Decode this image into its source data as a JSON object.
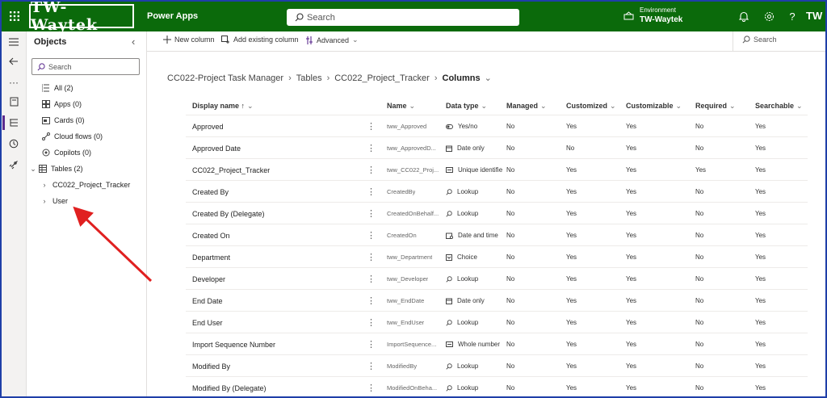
{
  "topbar": {
    "logo": "TW-Waytek",
    "app_name": "Power Apps",
    "search_placeholder": "Search",
    "environment_label": "Environment",
    "environment_name": "TW-Waytek",
    "avatar": "TW",
    "icons": [
      "waffle-icon",
      "notifications-icon",
      "settings-icon",
      "help-icon"
    ]
  },
  "objects": {
    "title": "Objects",
    "search_placeholder": "Search",
    "items": [
      {
        "label": "All",
        "count": "(2)",
        "icon": "list-icon"
      },
      {
        "label": "Apps",
        "count": "(0)",
        "icon": "apps-icon"
      },
      {
        "label": "Cards",
        "count": "(0)",
        "icon": "cards-icon"
      },
      {
        "label": "Cloud flows",
        "count": "(0)",
        "icon": "flow-icon"
      },
      {
        "label": "Copilots",
        "count": "(0)",
        "icon": "copilot-icon"
      },
      {
        "label": "Tables",
        "count": "(2)",
        "icon": "table-icon"
      }
    ],
    "tables": [
      "CC022_Project_Tracker",
      "User"
    ]
  },
  "commands": {
    "new_column": "New column",
    "add_existing": "Add existing column",
    "advanced": "Advanced",
    "search": "Search"
  },
  "breadcrumb": {
    "solution": "CC022-Project Task Manager",
    "tables": "Tables",
    "table": "CC022_Project_Tracker",
    "current": "Columns"
  },
  "grid": {
    "headers": [
      "Display name ↑",
      "Name",
      "Data type",
      "Managed",
      "Customized",
      "Customizable",
      "Required",
      "Searchable"
    ],
    "rows": [
      {
        "display": "Approved",
        "name": "tww_Approved",
        "type": "Yes/no",
        "type_icon": "toggle-icon",
        "managed": "No",
        "customized": "Yes",
        "customizable": "Yes",
        "required": "No",
        "searchable": "Yes"
      },
      {
        "display": "Approved Date",
        "name": "tww_ApprovedD...",
        "type": "Date only",
        "type_icon": "calendar-icon",
        "managed": "No",
        "customized": "No",
        "customizable": "Yes",
        "required": "No",
        "searchable": "Yes"
      },
      {
        "display": "CC022_Project_Tracker",
        "name": "tww_CC022_Proj...",
        "type": "Unique identifie",
        "type_icon": "id-icon",
        "managed": "No",
        "customized": "Yes",
        "customizable": "Yes",
        "required": "Yes",
        "searchable": "Yes"
      },
      {
        "display": "Created By",
        "name": "CreatedBy",
        "type": "Lookup",
        "type_icon": "lookup-icon",
        "managed": "No",
        "customized": "Yes",
        "customizable": "Yes",
        "required": "No",
        "searchable": "Yes"
      },
      {
        "display": "Created By (Delegate)",
        "name": "CreatedOnBehalf...",
        "type": "Lookup",
        "type_icon": "lookup-icon",
        "managed": "No",
        "customized": "Yes",
        "customizable": "Yes",
        "required": "No",
        "searchable": "Yes"
      },
      {
        "display": "Created On",
        "name": "CreatedOn",
        "type": "Date and time",
        "type_icon": "datetime-icon",
        "managed": "No",
        "customized": "Yes",
        "customizable": "Yes",
        "required": "No",
        "searchable": "Yes"
      },
      {
        "display": "Department",
        "name": "tww_Department",
        "type": "Choice",
        "type_icon": "choice-icon",
        "managed": "No",
        "customized": "Yes",
        "customizable": "Yes",
        "required": "No",
        "searchable": "Yes"
      },
      {
        "display": "Developer",
        "name": "tww_Developer",
        "type": "Lookup",
        "type_icon": "lookup-icon",
        "managed": "No",
        "customized": "Yes",
        "customizable": "Yes",
        "required": "No",
        "searchable": "Yes"
      },
      {
        "display": "End Date",
        "name": "tww_EndDate",
        "type": "Date only",
        "type_icon": "calendar-icon",
        "managed": "No",
        "customized": "Yes",
        "customizable": "Yes",
        "required": "No",
        "searchable": "Yes"
      },
      {
        "display": "End User",
        "name": "tww_EndUser",
        "type": "Lookup",
        "type_icon": "lookup-icon",
        "managed": "No",
        "customized": "Yes",
        "customizable": "Yes",
        "required": "No",
        "searchable": "Yes"
      },
      {
        "display": "Import Sequence Number",
        "name": "ImportSequence...",
        "type": "Whole number",
        "type_icon": "number-icon",
        "managed": "No",
        "customized": "Yes",
        "customizable": "Yes",
        "required": "No",
        "searchable": "Yes"
      },
      {
        "display": "Modified By",
        "name": "ModifiedBy",
        "type": "Lookup",
        "type_icon": "lookup-icon",
        "managed": "No",
        "customized": "Yes",
        "customizable": "Yes",
        "required": "No",
        "searchable": "Yes"
      },
      {
        "display": "Modified By (Delegate)",
        "name": "ModifiedOnBeha...",
        "type": "Lookup",
        "type_icon": "lookup-icon",
        "managed": "No",
        "customized": "Yes",
        "customizable": "Yes",
        "required": "No",
        "searchable": "Yes"
      }
    ]
  },
  "colors": {
    "topbar": "#0b6a0b",
    "outer_border": "#1f3fa8",
    "active_rail": "#5b2b8e",
    "annotation_arrow": "#e02020"
  }
}
